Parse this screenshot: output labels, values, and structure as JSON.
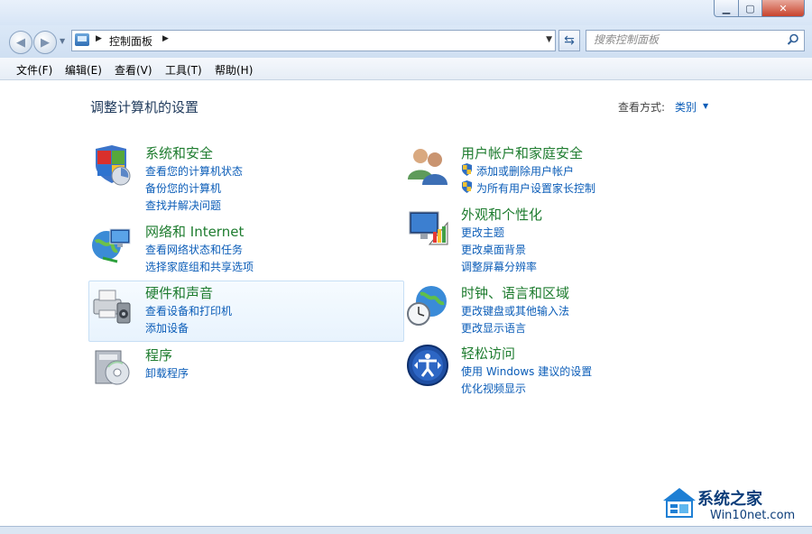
{
  "window": {
    "minimize_icon": "minimize-icon",
    "maximize_icon": "maximize-icon",
    "close_icon": "close-icon"
  },
  "address": {
    "back_icon": "back-arrow-icon",
    "forward_icon": "forward-arrow-icon",
    "breadcrumb_root_icon": "control-panel-icon",
    "breadcrumb": "控制面板",
    "refresh_icon": "refresh-icon",
    "search_placeholder": "搜索控制面板",
    "search_icon": "search-icon"
  },
  "menu": [
    "文件(F)",
    "编辑(E)",
    "查看(V)",
    "工具(T)",
    "帮助(H)"
  ],
  "page": {
    "title": "调整计算机的设置",
    "view_by_label": "查看方式:",
    "view_by_value": "类别"
  },
  "categories": [
    {
      "title": "系统和安全",
      "icon": "system-security-icon",
      "links": [
        "查看您的计算机状态",
        "备份您的计算机",
        "查找并解决问题"
      ]
    },
    {
      "title": "网络和 Internet",
      "icon": "network-internet-icon",
      "links": [
        "查看网络状态和任务",
        "选择家庭组和共享选项"
      ]
    },
    {
      "title": "硬件和声音",
      "icon": "hardware-sound-icon",
      "links": [
        "查看设备和打印机",
        "添加设备"
      ]
    },
    {
      "title": "程序",
      "icon": "programs-icon",
      "links": [
        "卸载程序"
      ]
    },
    {
      "title": "用户帐户和家庭安全",
      "icon": "user-accounts-icon",
      "links": [
        "添加或删除用户帐户",
        "为所有用户设置家长控制"
      ]
    },
    {
      "title": "外观和个性化",
      "icon": "appearance-icon",
      "links": [
        "更改主题",
        "更改桌面背景",
        "调整屏幕分辨率"
      ]
    },
    {
      "title": "时钟、语言和区域",
      "icon": "clock-region-icon",
      "links": [
        "更改键盘或其他输入法",
        "更改显示语言"
      ]
    },
    {
      "title": "轻松访问",
      "icon": "ease-of-access-icon",
      "links": [
        "使用 Windows 建议的设置",
        "优化视频显示"
      ]
    }
  ],
  "watermark": {
    "title": "系统之家",
    "url": "Win10net.com"
  },
  "colors": {
    "category_title": "#1e7c2f",
    "link": "#0b5db8",
    "page_title": "#1e395b"
  }
}
